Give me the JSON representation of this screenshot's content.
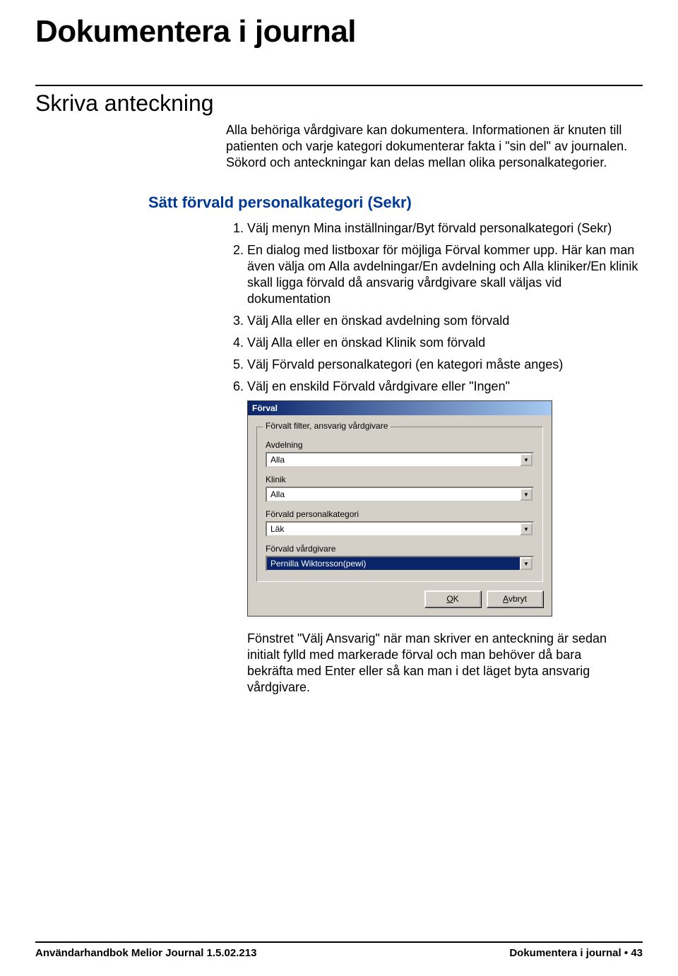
{
  "title": "Dokumentera i journal",
  "section_heading": "Skriva anteckning",
  "intro": "Alla behöriga vårdgivare kan dokumentera. Informationen är knuten till patienten och varje kategori dokumenterar fakta i \"sin del\" av journalen. Sökord och anteckningar kan delas mellan olika personalkategorier.",
  "sub_heading": "Sätt förvald personalkategori (Sekr)",
  "steps": {
    "s1": "Välj menyn Mina inställningar/Byt förvald personalkategori (Sekr)",
    "s2a": "En dialog med listboxar för möjliga Förval kommer upp.",
    "s2b": "Här kan man även välja om Alla avdelningar/En avdelning och Alla kliniker/En klinik skall ligga förvald då ansvarig vårdgivare skall väljas vid dokumentation",
    "s3": "Välj Alla eller en önskad avdelning som förvald",
    "s4": "Välj Alla eller en önskad Klinik som förvald",
    "s5": "Välj Förvald personalkategori (en kategori måste anges)",
    "s6": "Välj en enskild Förvald vårdgivare eller \"Ingen\""
  },
  "dialog": {
    "title": "Förval",
    "group_label": "Förvalt filter, ansvarig vårdgivare",
    "fields": {
      "avdelning": {
        "label": "Avdelning",
        "value": "Alla"
      },
      "klinik": {
        "label": "Klinik",
        "value": "Alla"
      },
      "kategori": {
        "label": "Förvald personalkategori",
        "value": "Läk"
      },
      "vardgivare": {
        "label": "Förvald vårdgivare",
        "value": "Pernilla Wiktorsson(pewi)"
      }
    },
    "buttons": {
      "ok_u": "O",
      "ok_rest": "K",
      "cancel_u": "A",
      "cancel_rest": "vbryt"
    }
  },
  "closing": "Fönstret \"Välj Ansvarig\" när man skriver en anteckning är sedan initialt fylld med markerade förval och man behöver då bara bekräfta med Enter eller så kan man i det läget byta ansvarig vårdgivare.",
  "footer": {
    "left": "Användarhandbok Melior Journal 1.5.02.213",
    "right_label": "Dokumentera i journal",
    "right_bullet": "•",
    "right_page": "43"
  }
}
